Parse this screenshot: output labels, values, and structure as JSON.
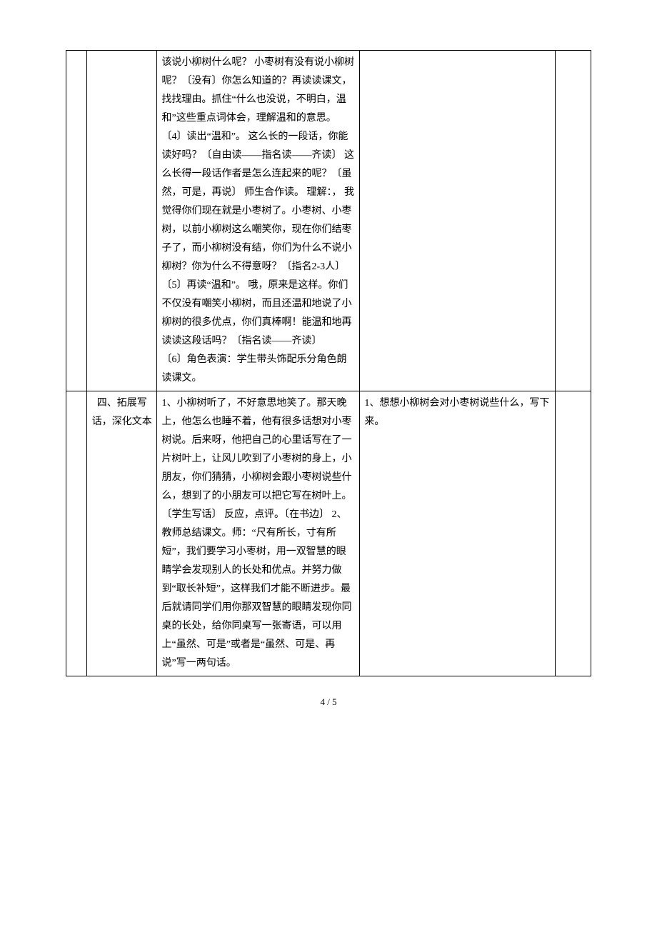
{
  "rows": [
    {
      "col1": "",
      "col2": "",
      "col3": "该说小柳树什么呢？  小枣树有没有说小柳树呢？〔没有〕你怎么知道的？再读读课文，找找理由。抓住“什么也没说，不明白，温和”这些重点词体会，理解温和的意思。\n〔4〕读出“温和”。  这么长的一段话，你能读好吗？〔自由读——指名读——齐读〕  这么长得一段话作者是怎么连起来的呢？〔虽然，可是，再说〕  师生合作读。  理解：，  我觉得你们现在就是小枣树了。小枣树、小枣树，以前小柳树这么嘲笑你，现在你们结枣子了，而小柳树没有结，你们为什么不说小柳树？你为什么不得意呀？〔指名2-3人〕\n〔5〕再读“温和”。  哦，原来是这样。你们不仅没有嘲笑小柳树，而且还温和地说了小柳树的很多优点，你们真棒啊！能温和地再读读这段话吗？〔指名读——齐读〕\n〔6〕角色表演：学生带头饰配乐分角色朗读课文。",
      "col4": "",
      "col5": ""
    },
    {
      "col1": "",
      "col2": "四、拓展写话，深化文本",
      "col3": "1、小柳树听了，不好意思地笑了。那天晚上，他怎么也睡不着，他有很多话想对小枣树说。后来呀，他把自己的心里话写在了一片树叶上，让风儿吹到了小枣树的身上，小朋友，你们猜猜，小柳树会跟小枣树说些什么，想到了的小朋友可以把它写在树叶上。〔学生写话〕  反应，点评。〔在书边〕   2、教师总结课文。师：“尺有所长，寸有所短”，我们要学习小枣树，用一双智慧的眼睛学会发现别人的长处和优点。并努力做到“取长补短”，这样我们才能不断进步。最后就请同学们用你那双智慧的眼睛发现你同桌的长处，给你同桌写一张寄语，可以用上“虽然、可是”或者是“虽然、可是、再说”写一两句话。",
      "col4": "1、想想小柳树会对小枣树说些什么，写下来。",
      "col5": ""
    }
  ],
  "footer": "4  /  5"
}
